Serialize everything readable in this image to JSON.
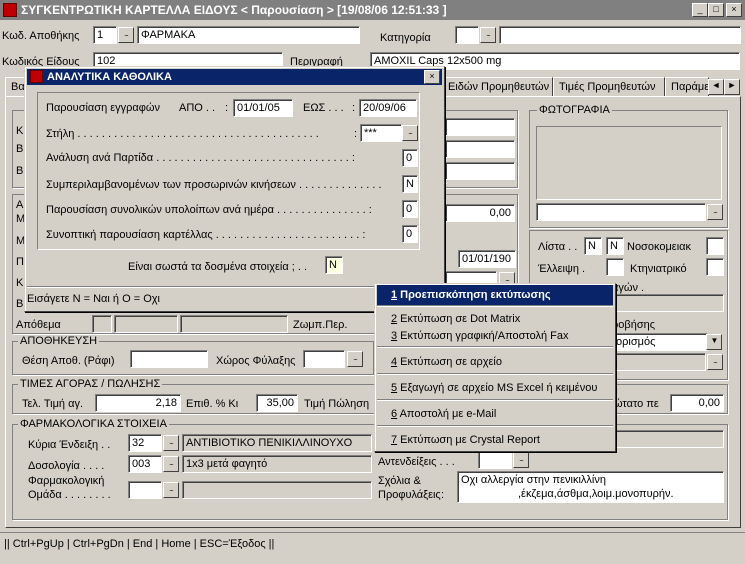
{
  "window": {
    "title": "ΣΥΓΚΕΝΤΡΩΤΙΚΗ ΚΑΡΤΕΛΛΑ ΕΙΔΟΥΣ < Παρουσίαση >   [19/08/06 12:51:33 ]",
    "icon_label": "L"
  },
  "header": {
    "warehouse_code_label": "Κωδ. Αποθήκης",
    "warehouse_code": "1",
    "warehouse_name": "ΦΑΡΜΑΚΑ",
    "category_label": "Κατηγορία",
    "category_code": "",
    "category_name": "",
    "item_code_label": "Κωδικός Είδους",
    "item_code": "102",
    "description_label": "Περιγραφή",
    "description": "AMOXIL Caps 12x500 mg"
  },
  "tabs": [
    "Βα",
    "Ειδών Προμηθευτών",
    "Τιμές Προμηθευτών",
    "Παράμε"
  ],
  "photo": {
    "title": "ΦΩΤΟΓΡΑΦΙΑ"
  },
  "background_fields": {
    "value_000": "0,00",
    "date_field": "01/01/190",
    "hidden_left_labels": [
      "Κ",
      "Β",
      "Β",
      "Α",
      "Μ",
      "Μ",
      "Π",
      "Κ",
      "Β"
    ],
    "stock_label": "Απόθεμα",
    "zomp_label": "Ζωμπ.Περ.",
    "supplier_frag": "αγών .",
    "provision_frag": "ροβήσης",
    "schedule_value": "ορισμός"
  },
  "list_panel": {
    "list_label": "Λίστα . .",
    "list_val1": "N",
    "list_val2": "N",
    "hospital_label": "Νοσοκομειακ",
    "shortage_label": "Έλλειψη .",
    "veterinary_label": "Κτηνιατρικό"
  },
  "storage": {
    "title": "ΑΠΟΘΗΚΕΥΣΗ",
    "position_label": "Θέση Αποθ. (Ράφι)",
    "space_label": "Χώρος Φύλαξης"
  },
  "prices": {
    "title": "ΤΙΜΕΣ ΑΓΟΡΑΣ / ΠΩΛΗΣΗΣ",
    "buy_label": "Τελ. Τιμή αγ.",
    "buy_value": "2,18",
    "markup_label": "Επιθ. % Κι",
    "markup_value": "35,00",
    "sell_label": "Τιμή Πώληση",
    "max_label": "ώτατο πε",
    "max_value": "0,00"
  },
  "pharma": {
    "title": "ΦΑΡΜΑΚΟΛΟΓΙΚΑ ΣΤΟΙΧΕΙΑ",
    "indication_label": "Κύρια Ένδειξη . .",
    "indication_code": "32",
    "indication_name": "ΑΝΤΙΒΙΟΤΙΚΟ ΠΕΝΙΚΙΛΛΙΝΟΥΧΟ",
    "dosage_label": "Δοσολογία . . . .",
    "dosage_code": "003",
    "dosage_name": "1x3 μετά φαγητό",
    "group_label1": "Φαρμακολογική",
    "group_label2": "Ομάδα . . . . . . . .",
    "contra_label": "Αντενδείξεις . . .",
    "notes_label1": "Σχόλια &",
    "notes_label2": "Προφυλάξεις",
    "notes_line1": "Οχι αλλεργία στην πενικιλλίνη",
    "notes_line2": ",έκζεμα,άσθμα,λοιμ.μονοπυρήν."
  },
  "dialog": {
    "title": "ΑΝΑΛΥΤΙΚΑ ΚΑΘΟΛΙΚΑ",
    "show_records_label": "Παρουσίαση εγγραφών",
    "from_label": "ΑΠΟ . .",
    "from_date": "01/01/05",
    "to_label": "ΕΩΣ . . .",
    "to_date": "20/09/06",
    "column_label": "Στήλη . . . . . . . . . . . . . . . . . . . . . . . . . . . . . . . . . . . . . . . .",
    "column_value": "***",
    "batch_label": "Ανάλυση ανά Παρτίδα . . . . . . . . . . . . . . . . . . . . . . . . . . . . . . . . :",
    "batch_value": "0",
    "temp_label": "Συμπεριλαμβανομένων των προσωρινών κινήσεων . . . . . . . . . . . . . .",
    "temp_value": "N",
    "daily_label": "Παρουσίαση συνολικών υπολοίπων ανά ημέρα . . . . . . . . . . . . . . . :",
    "daily_value": "0",
    "summary_label": "Συνοπτική παρουσίαση καρτέλλας . . . . . . . . . . . . . . . . . . . . . . . . :",
    "summary_value": "0",
    "confirm_label": "Είναι σωστά τα δοσμένα στοιχεία ; . .",
    "confirm_value": "N",
    "hint": "Εισάγετε N = Ναι  ή  O = Οχι"
  },
  "menu": {
    "items": [
      {
        "num": "1",
        "label": " Προεπισκόπηση εκτύπωσης"
      },
      {
        "num": "2",
        "label": " Εκτύπωση σε Dot Matrix"
      },
      {
        "num": "3",
        "label": " Εκτύπωση γραφική/Αποστολή Fax"
      },
      {
        "num": "4",
        "label": " Εκτύπωση σε αρχείο"
      },
      {
        "num": "5",
        "label": " Εξαγωγή σε αρχείο MS Excel ή κειμένου"
      },
      {
        "num": "6",
        "label": " Αποστολή με e-Mail"
      },
      {
        "num": "7",
        "label": " Εκτύπωση με Crystal Report"
      }
    ]
  },
  "status": {
    "text": "|| Ctrl+PgUp | Ctrl+PgDn | End | Home | ESC=Έξοδος ||"
  },
  "colors": {
    "title_active": "#0a246a",
    "title_inactive": "#808080",
    "face": "#d4d0c8",
    "highlight": "#0a246a"
  }
}
